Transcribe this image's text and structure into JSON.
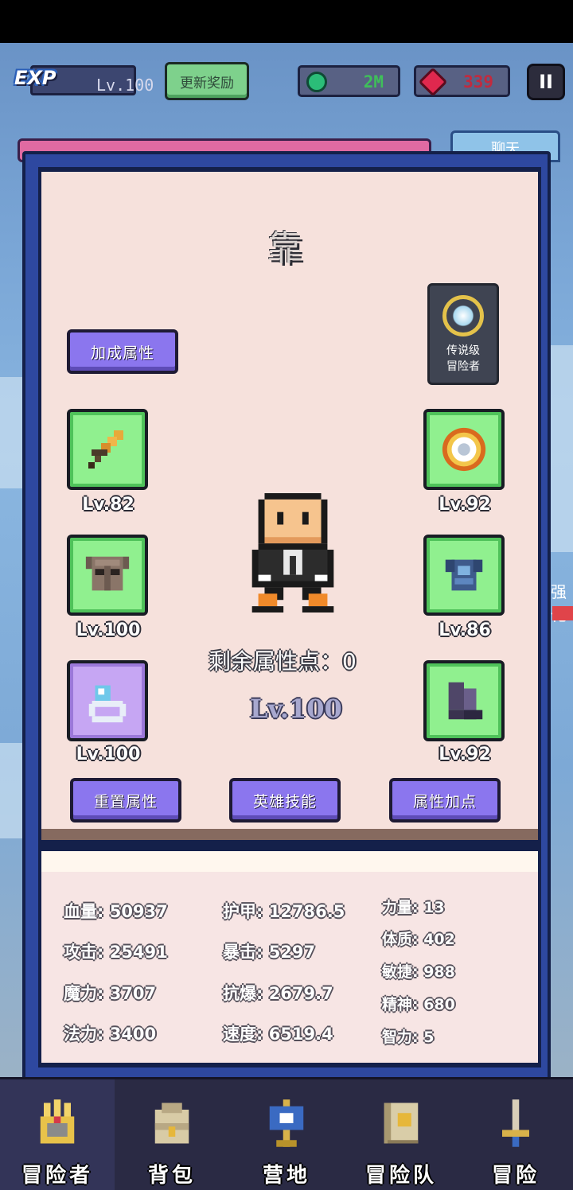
{
  "topbar": {
    "exp_badge": "EXP",
    "level": "Lv.100",
    "reward_button": "更新奖励",
    "gems": "2M",
    "rubies": "339",
    "pause": "II"
  },
  "side": {
    "chat_tab": "聊天",
    "edge_text": "强化"
  },
  "hero": {
    "name_glyph": "靠",
    "legend_line1": "传说级",
    "legend_line2": "冒险者",
    "bonus_button": "加成属性",
    "remaining_points": "剩余属性点：0",
    "level": "Lv.100"
  },
  "equipment": {
    "weapon": {
      "level": "Lv.82",
      "icon": "sword-icon"
    },
    "helmet": {
      "level": "Lv.100",
      "icon": "helmet-icon"
    },
    "ring": {
      "level": "Lv.100",
      "icon": "ring-icon"
    },
    "shield": {
      "level": "Lv.92",
      "icon": "shield-icon"
    },
    "armor": {
      "level": "Lv.86",
      "icon": "armor-icon"
    },
    "boots": {
      "level": "Lv.92",
      "icon": "boots-icon"
    }
  },
  "actions": {
    "reset": "重置属性",
    "skills": "英雄技能",
    "allocate": "属性加点"
  },
  "stats": {
    "hp": "血量: 50937",
    "attack": "攻击: 25491",
    "magic": "魔力: 3707",
    "mana": "法力: 3400",
    "armor": "护甲: 12786.5",
    "crit": "暴击: 5297",
    "crit_resist": "抗爆: 2679.7",
    "speed": "速度: 6519.4",
    "strength": "力量: 13",
    "constitution": "体质: 402",
    "agility": "敏捷: 988",
    "spirit": "精神: 680",
    "intellect": "智力: 5"
  },
  "nav": [
    {
      "label": "冒险者",
      "icon": "helmet-crown-icon"
    },
    {
      "label": "背包",
      "icon": "backpack-icon"
    },
    {
      "label": "营地",
      "icon": "camp-banner-icon"
    },
    {
      "label": "冒险队",
      "icon": "book-icon"
    },
    {
      "label": "冒险",
      "icon": "sword-upright-icon"
    }
  ],
  "colors": {
    "panel_bg": "#f6e1dc",
    "modal_border": "#2e48a0",
    "slot_green": "#90f08f",
    "slot_purple": "#c6a6f3",
    "button_purple": "#8b76ee"
  }
}
